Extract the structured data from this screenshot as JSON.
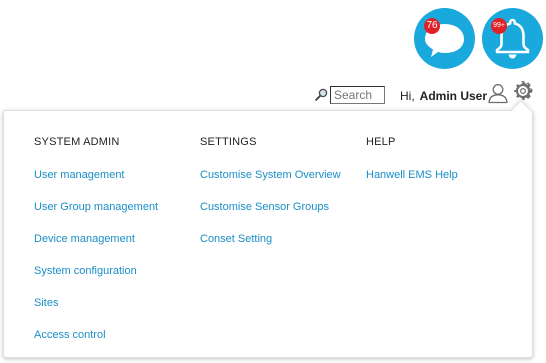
{
  "header": {
    "messages_badge": "76",
    "alerts_badge": "99+",
    "search": {
      "placeholder": "Search",
      "value": ""
    },
    "greeting": "Hi,",
    "username": "Admin User",
    "icons": {
      "messages": "chat-bubble-icon",
      "alerts": "bell-icon",
      "search": "magnifier-icon",
      "user": "user-icon",
      "settings": "gear-icon"
    },
    "colors": {
      "notification_bg": "#19a9dc",
      "badge": "#e12128",
      "link": "#1a8fc7"
    }
  },
  "menu": {
    "system_admin": {
      "heading": "SYSTEM ADMIN",
      "items": [
        "User management",
        "User Group management",
        "Device management",
        "System configuration",
        "Sites",
        "Access control"
      ]
    },
    "settings": {
      "heading": "SETTINGS",
      "items": [
        "Customise System Overview",
        "Customise Sensor Groups",
        "Conset Setting"
      ]
    },
    "help": {
      "heading": "HELP",
      "items": [
        "Hanwell EMS Help"
      ]
    }
  }
}
